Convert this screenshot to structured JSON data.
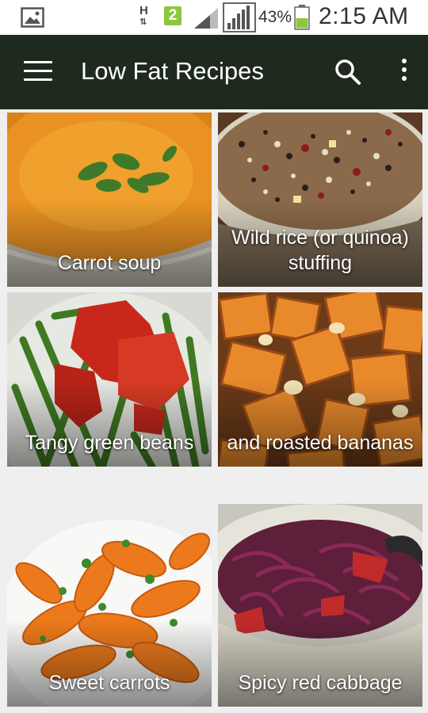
{
  "status_bar": {
    "network_type": "H",
    "sim_badge": "2",
    "battery_percent": "43%",
    "time": "2:15 AM",
    "icons": [
      "gallery-icon",
      "data-arrows-icon",
      "signal-icon",
      "battery-icon"
    ]
  },
  "app_bar": {
    "title": "Low Fat Recipes",
    "icons": [
      "menu-icon",
      "search-icon",
      "more-vert-icon"
    ],
    "color": "#1f2a1f"
  },
  "recipes": [
    {
      "label": "Carrot soup"
    },
    {
      "label": "Wild rice (or quinoa) stuffing"
    },
    {
      "label": "Tangy green beans"
    },
    {
      "label": "and roasted bananas"
    },
    {
      "label": "Sweet carrots"
    },
    {
      "label": "Spicy red cabbage"
    }
  ]
}
